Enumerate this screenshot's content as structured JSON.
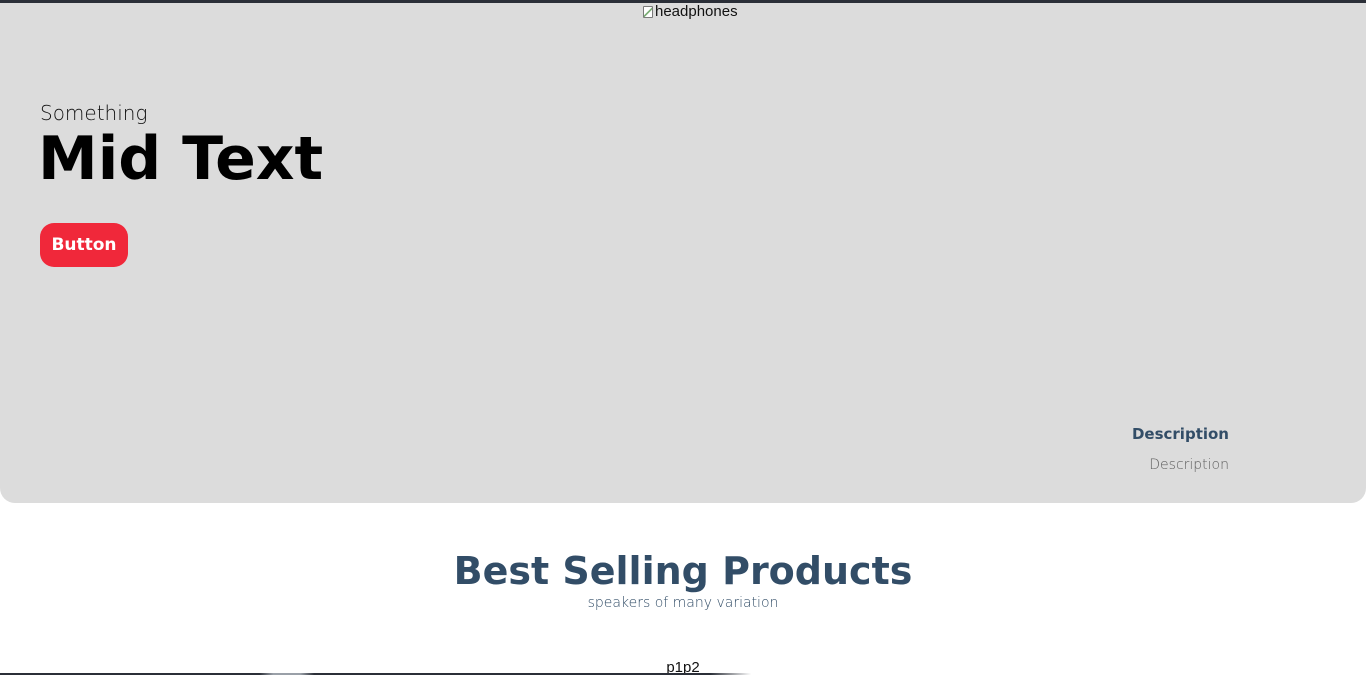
{
  "hero": {
    "image_alt": "headphones",
    "small_text": "Something",
    "title": "Mid Text",
    "button_label": "Button",
    "description_title": "Description",
    "description_text": "Description",
    "background_color": "#dcdcdc",
    "button_color": "#f0283a"
  },
  "best_selling": {
    "title": "Best Selling Products",
    "subtitle": "speakers of many variation",
    "title_color": "#324d67"
  },
  "products": {
    "items_text": "p1p2"
  }
}
